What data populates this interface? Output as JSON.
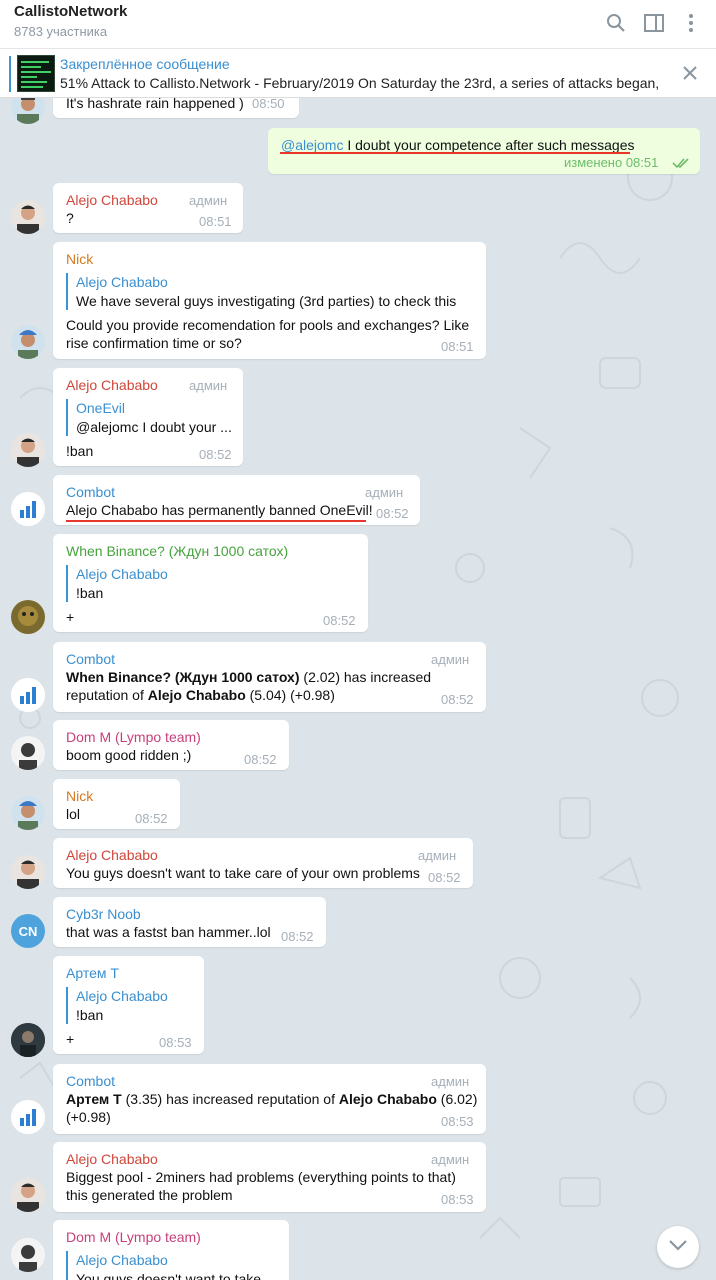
{
  "header": {
    "title": "CallistoNetwork",
    "members": "8783 участника"
  },
  "pinned": {
    "label": "Закреплённое сообщение",
    "text": "51% Attack to Callisto.Network - February/2019  On Saturday the 23rd, a series of attacks began,..."
  },
  "messages": {
    "m0": {
      "text": "It's hashrate rain happened )",
      "time": "08:50"
    },
    "m1": {
      "mention": "@alejomc",
      "text": " I doubt your competence after such messages",
      "edited": "изменено 08:51"
    },
    "m2": {
      "sender": "Alejo Chababo",
      "admin": "админ",
      "text": "?",
      "time": "08:51"
    },
    "m3": {
      "sender": "Nick",
      "reply_name": "Alejo Chababo",
      "reply_text": "We have several guys investigating (3rd parties) to check this",
      "line1": "Could you provide recomendation for pools and exchanges? Like",
      "line2": "rise confirmation time or so?",
      "time": "08:51"
    },
    "m4": {
      "sender": "Alejo Chababo",
      "admin": "админ",
      "reply_name": "OneEvil",
      "reply_text": "@alejomc I doubt your ...",
      "text": "!ban",
      "time": "08:52"
    },
    "m5": {
      "sender": "Combot",
      "admin": "админ",
      "text": "Alejo Chababo has permanently banned OneEvil!",
      "time": "08:52"
    },
    "m6": {
      "sender": "When Binance? (Ждун 1000 сатох)",
      "reply_name": "Alejo Chababo",
      "reply_text": "!ban",
      "text": "+",
      "time": "08:52"
    },
    "m7": {
      "sender": "Combot",
      "admin": "админ",
      "b1": "When Binance? (Ждун 1000 сатох)",
      "t1": " (2.02) has increased",
      "t2": "reputation of ",
      "b2": "Alejo Chababo",
      "t3": " (5.04) (+0.98)",
      "time": "08:52"
    },
    "m8": {
      "sender": "Dom M (Lympo team)",
      "text": "boom good ridden ;)",
      "time": "08:52"
    },
    "m9": {
      "sender": "Nick",
      "text": "lol",
      "time": "08:52"
    },
    "m10": {
      "sender": "Alejo Chababo",
      "admin": "админ",
      "text": "You guys doesn't want to take care of your own problems",
      "time": "08:52"
    },
    "m11": {
      "sender": "Cyb3r Noob",
      "avatar": "CN",
      "text": "that was a fastst ban hammer..lol",
      "time": "08:52"
    },
    "m12": {
      "sender": "Артем Т",
      "reply_name": "Alejo Chababo",
      "reply_text": "!ban",
      "text": "+",
      "time": "08:53"
    },
    "m13": {
      "sender": "Combot",
      "admin": "админ",
      "b1": "Артем Т",
      "t1": " (3.35) has increased reputation of ",
      "b2": "Alejo Chababo",
      "t2": " (6.02)",
      "t3": "(+0.98)",
      "time": "08:53"
    },
    "m14": {
      "sender": "Alejo Chababo",
      "admin": "админ",
      "line1": "Biggest pool - 2miners had problems (everything points to that)",
      "line2": "this generated the problem",
      "time": "08:53"
    },
    "m15": {
      "sender": "Dom M (Lympo team)",
      "reply_name": "Alejo Chababo",
      "reply_text": "You guys doesn't want to take"
    }
  },
  "colors": {
    "alejo": "#d0463a",
    "nick": "#d67a1e",
    "combot": "#3a8fd0",
    "binance": "#46a33d",
    "dom": "#c8407a",
    "cyb3r": "#3a8fd0",
    "artem": "#3a8fd0",
    "underline": "#e8362a",
    "chat_bg": "#dde4e9",
    "outgoing_bubble": "#eefedf"
  },
  "icons": [
    "search-icon",
    "sidebar-toggle-icon",
    "more-vertical-icon",
    "close-icon",
    "chevron-down-icon",
    "double-check-icon",
    "pin-bar"
  ]
}
